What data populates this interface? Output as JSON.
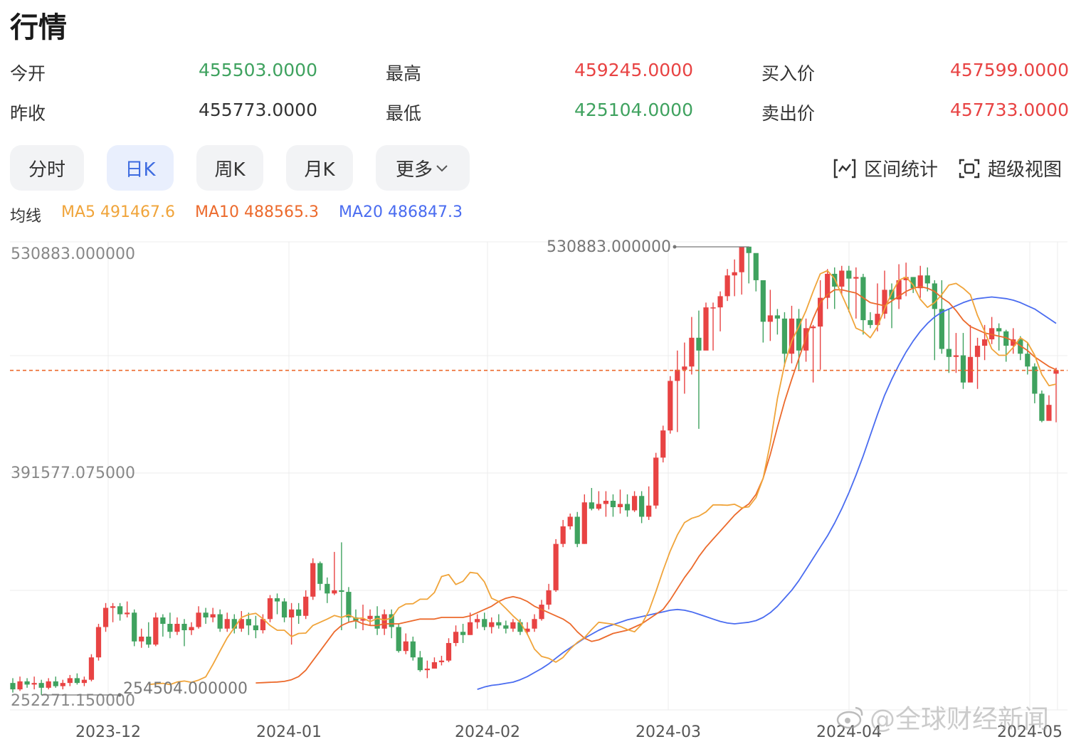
{
  "header": {
    "title": "行情"
  },
  "quote": {
    "open_label": "今开",
    "open": "455503.0000",
    "prev_close_label": "昨收",
    "prev_close": "455773.0000",
    "high_label": "最高",
    "high": "459245.0000",
    "low_label": "最低",
    "low": "425104.0000",
    "bid_label": "买入价",
    "bid": "457599.0000",
    "ask_label": "卖出价",
    "ask": "457733.0000"
  },
  "tabs": [
    {
      "label": "分时",
      "active": false
    },
    {
      "label": "日K",
      "active": true
    },
    {
      "label": "周K",
      "active": false
    },
    {
      "label": "月K",
      "active": false
    },
    {
      "label": "更多",
      "active": false
    }
  ],
  "tools": {
    "range_stats": "区间统计",
    "super_view": "超级视图"
  },
  "ma": {
    "label": "均线",
    "ma5": "MA5 491467.6",
    "ma10": "MA10 488565.3",
    "ma20": "MA20 486847.3"
  },
  "colors": {
    "up": "#e84343",
    "down": "#3fa25f",
    "ma5": "#f0a43a",
    "ma10": "#ec6a2c",
    "ma20": "#4a6cf0",
    "current_line": "#ec6a2c"
  },
  "watermark": "@全球财经新闻",
  "chart_data": {
    "type": "candlestick",
    "y_axis_labels": [
      "530883.000000",
      "391577.075000",
      "252271.150000"
    ],
    "x_tick_labels": [
      "2023-12",
      "2024-01",
      "2024-02",
      "2024-03",
      "2024-04",
      "2024-05"
    ],
    "max_annotation": "530883.000000",
    "min_annotation": "254504.000000",
    "current_price_line": 457599,
    "ylim": [
      252271.15,
      530883
    ],
    "series_names": [
      "MA5",
      "MA10",
      "MA20"
    ],
    "candles": [
      [
        262000,
        258000,
        265000,
        256000
      ],
      [
        258000,
        263000,
        266000,
        257000
      ],
      [
        263000,
        261000,
        265000,
        259000
      ],
      [
        261000,
        262000,
        266000,
        258000
      ],
      [
        262000,
        259000,
        264000,
        254504
      ],
      [
        259000,
        263000,
        265000,
        258000
      ],
      [
        263000,
        260000,
        266000,
        259000
      ],
      [
        260000,
        262000,
        264000,
        258000
      ],
      [
        262000,
        265000,
        267000,
        260000
      ],
      [
        265000,
        262000,
        268000,
        261000
      ],
      [
        262000,
        264000,
        266000,
        260000
      ],
      [
        264000,
        278000,
        280000,
        263000
      ],
      [
        278000,
        297000,
        299000,
        276000
      ],
      [
        297000,
        309000,
        312000,
        294000
      ],
      [
        309000,
        310000,
        312000,
        300000
      ],
      [
        310000,
        305000,
        312000,
        301000
      ],
      [
        305000,
        306000,
        313000,
        303000
      ],
      [
        306000,
        288000,
        308000,
        285000
      ],
      [
        288000,
        291000,
        296000,
        284000
      ],
      [
        291000,
        286000,
        300000,
        284000
      ],
      [
        286000,
        303000,
        306000,
        285000
      ],
      [
        303000,
        299000,
        305000,
        291000
      ],
      [
        299000,
        294000,
        306000,
        290000
      ],
      [
        294000,
        299000,
        303000,
        292000
      ],
      [
        299000,
        295000,
        302000,
        285000
      ],
      [
        295000,
        297000,
        300000,
        292000
      ],
      [
        297000,
        306000,
        310000,
        296000
      ],
      [
        306000,
        303000,
        309000,
        299000
      ],
      [
        303000,
        305000,
        309000,
        300000
      ],
      [
        305000,
        296000,
        308000,
        294000
      ],
      [
        296000,
        302000,
        306000,
        294000
      ],
      [
        302000,
        296000,
        305000,
        293000
      ],
      [
        296000,
        302000,
        307000,
        294000
      ],
      [
        302000,
        298000,
        306000,
        292000
      ],
      [
        298000,
        295000,
        304000,
        290000
      ],
      [
        295000,
        302000,
        305000,
        293000
      ],
      [
        302000,
        315000,
        317000,
        300000
      ],
      [
        315000,
        313000,
        318000,
        305000
      ],
      [
        313000,
        303000,
        315000,
        300000
      ],
      [
        303000,
        308000,
        312000,
        286000
      ],
      [
        308000,
        304000,
        312000,
        299000
      ],
      [
        304000,
        316000,
        320000,
        302000
      ],
      [
        316000,
        337000,
        340000,
        314000
      ],
      [
        337000,
        324000,
        338000,
        320000
      ],
      [
        324000,
        318000,
        328000,
        312000
      ],
      [
        318000,
        320000,
        344000,
        317000
      ],
      [
        320000,
        319000,
        350000,
        295000
      ],
      [
        319000,
        303000,
        322000,
        300000
      ],
      [
        303000,
        301000,
        308000,
        296000
      ],
      [
        301000,
        302000,
        311000,
        295000
      ],
      [
        302000,
        304000,
        308000,
        298000
      ],
      [
        304000,
        296000,
        310000,
        292000
      ],
      [
        296000,
        305000,
        308000,
        292000
      ],
      [
        305000,
        297000,
        308000,
        290000
      ],
      [
        297000,
        282000,
        299000,
        281000
      ],
      [
        282000,
        288000,
        293000,
        280000
      ],
      [
        288000,
        278000,
        291000,
        276000
      ],
      [
        278000,
        270000,
        282000,
        269000
      ],
      [
        270000,
        271000,
        276000,
        265000
      ],
      [
        271000,
        275000,
        278000,
        272000
      ],
      [
        275000,
        276000,
        279000,
        273000
      ],
      [
        276000,
        287000,
        290000,
        275000
      ],
      [
        287000,
        294000,
        298000,
        285000
      ],
      [
        294000,
        292000,
        299000,
        287000
      ],
      [
        292000,
        300000,
        306000,
        292000
      ],
      [
        300000,
        302000,
        305000,
        296000
      ],
      [
        302000,
        297000,
        306000,
        295000
      ],
      [
        297000,
        300000,
        303000,
        293000
      ],
      [
        300000,
        298000,
        305000,
        296000
      ],
      [
        298000,
        296000,
        301000,
        293000
      ],
      [
        296000,
        300000,
        302000,
        294000
      ],
      [
        300000,
        294000,
        302000,
        292000
      ],
      [
        294000,
        296000,
        300000,
        292000
      ],
      [
        296000,
        302000,
        305000,
        294000
      ],
      [
        302000,
        311000,
        314000,
        301000
      ],
      [
        311000,
        320000,
        324000,
        308000
      ],
      [
        320000,
        349000,
        352000,
        319000
      ],
      [
        349000,
        360000,
        364000,
        347000
      ],
      [
        360000,
        366000,
        368000,
        358000
      ],
      [
        366000,
        349000,
        369000,
        347000
      ],
      [
        349000,
        375000,
        380000,
        349000
      ],
      [
        375000,
        371000,
        384000,
        370000
      ],
      [
        371000,
        374000,
        382000,
        370000
      ],
      [
        374000,
        376000,
        382000,
        366000
      ],
      [
        376000,
        372000,
        380000,
        366000
      ],
      [
        372000,
        374000,
        383000,
        368000
      ],
      [
        374000,
        370000,
        380000,
        366000
      ],
      [
        370000,
        379000,
        382000,
        369000
      ],
      [
        379000,
        366000,
        382000,
        362000
      ],
      [
        366000,
        373000,
        385000,
        364000
      ],
      [
        373000,
        403000,
        406000,
        371000
      ],
      [
        403000,
        420000,
        423000,
        400000
      ],
      [
        420000,
        451000,
        454000,
        418000
      ],
      [
        451000,
        458000,
        470000,
        419000
      ],
      [
        458000,
        460000,
        475000,
        443000
      ],
      [
        460000,
        478000,
        491000,
        455000
      ],
      [
        478000,
        470000,
        495000,
        421000
      ],
      [
        470000,
        497000,
        500000,
        478000
      ],
      [
        497000,
        497000,
        500000,
        470000
      ],
      [
        497000,
        504000,
        507000,
        482000
      ],
      [
        504000,
        517000,
        521000,
        501000
      ],
      [
        517000,
        519000,
        527000,
        504000
      ],
      [
        519000,
        535000,
        530883,
        505000
      ],
      [
        535000,
        531000,
        534000,
        512000
      ],
      [
        531000,
        514000,
        530883,
        507000
      ],
      [
        514000,
        488000,
        512000,
        475000
      ],
      [
        488000,
        492000,
        508000,
        476000
      ],
      [
        492000,
        490000,
        496000,
        480000
      ],
      [
        490000,
        468000,
        494000,
        460000
      ],
      [
        468000,
        490000,
        498000,
        462000
      ],
      [
        490000,
        470000,
        496000,
        458000
      ],
      [
        470000,
        484000,
        490000,
        463000
      ],
      [
        484000,
        485000,
        486000,
        450000
      ],
      [
        485000,
        503000,
        514000,
        458000
      ],
      [
        503000,
        518000,
        521000,
        496000
      ],
      [
        518000,
        510000,
        522000,
        496000
      ],
      [
        510000,
        520000,
        523000,
        505000
      ],
      [
        520000,
        515000,
        523000,
        494000
      ],
      [
        515000,
        516000,
        522000,
        490000
      ],
      [
        516000,
        489000,
        518000,
        480000
      ],
      [
        489000,
        486000,
        494000,
        484000
      ],
      [
        486000,
        493000,
        512000,
        482000
      ],
      [
        493000,
        508000,
        520000,
        490000
      ],
      [
        508000,
        502000,
        512000,
        484000
      ],
      [
        502000,
        514000,
        524000,
        496000
      ],
      [
        514000,
        516000,
        525000,
        504000
      ],
      [
        516000,
        509000,
        516000,
        506000
      ],
      [
        509000,
        517000,
        523000,
        503000
      ],
      [
        517000,
        512000,
        522000,
        507000
      ],
      [
        512000,
        496000,
        514000,
        464000
      ],
      [
        496000,
        471000,
        514000,
        468000
      ],
      [
        471000,
        466000,
        496000,
        456000
      ],
      [
        466000,
        467000,
        481000,
        456000
      ],
      [
        467000,
        450000,
        481000,
        446000
      ],
      [
        450000,
        466000,
        486000,
        454000
      ],
      [
        466000,
        473000,
        478000,
        446000
      ],
      [
        473000,
        477000,
        486000,
        464000
      ],
      [
        477000,
        484000,
        491000,
        474000
      ],
      [
        484000,
        482000,
        487000,
        470000
      ],
      [
        482000,
        473000,
        483000,
        463000
      ],
      [
        473000,
        477000,
        484000,
        468000
      ],
      [
        477000,
        468000,
        479000,
        464000
      ],
      [
        468000,
        460000,
        475000,
        455000
      ],
      [
        460000,
        443000,
        462000,
        437000
      ],
      [
        443000,
        426000,
        445000,
        425104
      ],
      [
        426000,
        436000,
        442000,
        432000
      ],
      [
        455503,
        457733,
        459245,
        425104
      ]
    ],
    "ma5": [
      261000,
      261500,
      261800,
      261000,
      262600,
      263200,
      262400,
      263800,
      265800,
      273600,
      282000,
      290200,
      296600,
      303000,
      304800,
      305600,
      302200,
      298000,
      295000,
      295000,
      291000,
      293000,
      293200,
      298000,
      300000,
      302000,
      304200,
      303000,
      304600,
      302400,
      302600,
      300400,
      302400,
      301400,
      302600,
      309000,
      311400,
      311600,
      314400,
      314400,
      318600,
      328600,
      329800,
      323600,
      325600,
      331200,
      330600,
      325200,
      315000,
      313000,
      308600,
      304000,
      300000,
      292600,
      283200,
      278600,
      277400,
      275000,
      278000,
      283200,
      287400,
      290400,
      295400,
      300000,
      299400,
      298800,
      297400,
      295400,
      294000,
      298600,
      307000,
      319200,
      332400,
      344600,
      354600,
      362400,
      365000,
      366400,
      369000,
      373400,
      373400,
      373200,
      373800,
      371600,
      372200,
      378000,
      390000,
      412000,
      440000,
      461200,
      476000,
      485000,
      495000,
      507000,
      518000,
      520000,
      515000,
      505000,
      495000,
      484000,
      482000,
      478000,
      485000,
      496000,
      506000,
      514000,
      516000,
      511000,
      502000,
      497000,
      500000,
      505000,
      511000,
      512000,
      509000,
      505000,
      492000,
      482000,
      471000,
      467000,
      467000,
      472000,
      478000,
      475000,
      467000,
      455000,
      448000,
      449000
    ],
    "ma10": [
      262000,
      262200,
      262400,
      262600,
      263000,
      264000,
      266000,
      270000,
      276000,
      282000,
      288000,
      294000,
      298000,
      300000,
      301000,
      299000,
      298000,
      298000,
      299000,
      299000,
      299000,
      300000,
      301000,
      302000,
      302000,
      302000,
      303000,
      303000,
      303000,
      303000,
      304000,
      306000,
      308000,
      310000,
      313000,
      315000,
      316000,
      315000,
      313000,
      310000,
      308000,
      306000,
      304000,
      302000,
      299000,
      294000,
      290000,
      288000,
      289000,
      291000,
      293000,
      294000,
      295000,
      297000,
      299000,
      302000,
      305000,
      308000,
      314000,
      321000,
      328000,
      334000,
      341000,
      347000,
      352000,
      357000,
      362000,
      367000,
      371000,
      374000,
      380000,
      390000,
      405000,
      422000,
      438000,
      452000,
      465000,
      478000,
      490000,
      500000,
      505000,
      508000,
      508000,
      507000,
      506000,
      503000,
      500000,
      499000,
      498000,
      501000,
      504000,
      507000,
      509000,
      510000,
      509000,
      507000,
      503000,
      500000,
      495000,
      489000,
      485000,
      483000,
      481000,
      480000,
      479000,
      478000,
      476000,
      473000,
      470000,
      466000,
      463000,
      460000,
      458000
    ],
    "ma20": [
      258000,
      259500,
      260500,
      261000,
      261800,
      262500,
      264000,
      266000,
      268500,
      271000,
      274000,
      277500,
      281000,
      284000,
      287000,
      290000,
      292500,
      295000,
      297000,
      298500,
      300000,
      301500,
      302500,
      303500,
      304500,
      305500,
      306500,
      307500,
      308000,
      307500,
      306500,
      305000,
      303500,
      302000,
      300500,
      299500,
      299000,
      299500,
      300000,
      301000,
      303000,
      306000,
      310000,
      315000,
      320000,
      326000,
      333000,
      340000,
      347000,
      354000,
      362000,
      371000,
      381000,
      392000,
      404000,
      417000,
      430000,
      442000,
      452000,
      461000,
      469000,
      476000,
      482000,
      487000,
      491000,
      494000,
      496000,
      498000,
      500000,
      501500,
      502500,
      503000,
      503500,
      503000,
      502500,
      501500,
      500000,
      498000,
      496000,
      493000,
      490000,
      487000
    ]
  }
}
